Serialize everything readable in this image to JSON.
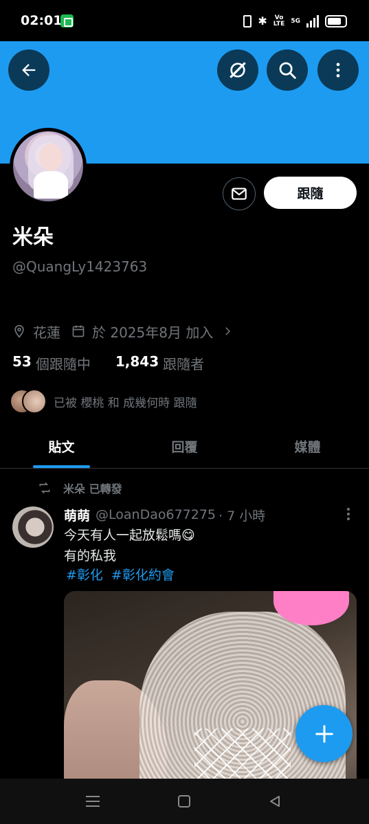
{
  "status_bar": {
    "time": "02:01",
    "network_label": "5G",
    "volte_top": "Vo",
    "volte_bottom": "LTE"
  },
  "profile": {
    "display_name": "米朵",
    "handle": "@QuangLy1423763",
    "location": "花蓮",
    "joined": "於 2025年8月 加入",
    "following_count": "53",
    "following_label": "個跟隨中",
    "followers_count": "1,843",
    "followers_label": "跟隨者",
    "followed_by_text": "已被 櫻桃 和 成幾何時 跟隨",
    "follow_button_label": "跟隨",
    "banner_color": "#1d9bf0"
  },
  "tabs": [
    {
      "label": "貼文",
      "active": true
    },
    {
      "label": "回覆",
      "active": false
    },
    {
      "label": "媒體",
      "active": false
    }
  ],
  "tweet": {
    "repost_text": "米朵 已轉發",
    "author_name": "萌萌",
    "author_handle": "@LoanDao677275",
    "time": "· 7 小時",
    "line1": "今天有人一起放鬆嗎😋",
    "line2": "有的私我",
    "hashtags": [
      "#彰化",
      "#彰化約會"
    ]
  },
  "colors": {
    "accent": "#1d9bf0",
    "background": "#000000",
    "secondary_text": "#71767b"
  },
  "icons": {
    "back": "arrow-left-icon",
    "grok": "grok-icon",
    "search": "search-icon",
    "more": "more-vertical-icon",
    "message": "mail-icon",
    "location": "location-pin-icon",
    "calendar": "calendar-icon",
    "repost": "repost-icon",
    "compose": "plus-icon"
  }
}
